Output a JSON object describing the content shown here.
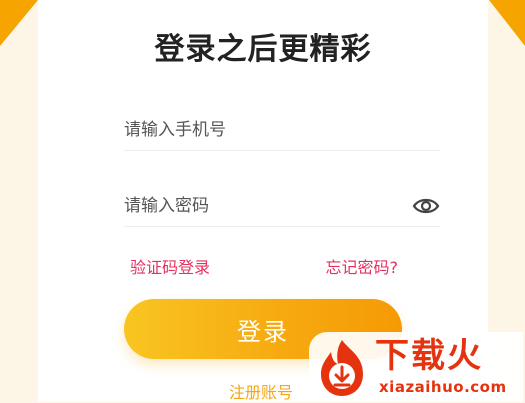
{
  "page": {
    "title": "登录之后更精彩"
  },
  "form": {
    "phone_placeholder": "请输入手机号",
    "password_placeholder": "请输入密码",
    "password_toggle_icon": "eye-icon",
    "code_login_label": "验证码登录",
    "forgot_password_label": "忘记密码?",
    "login_button_label": "登录",
    "register_label": "注册账号"
  },
  "watermark": {
    "title": "下载火",
    "url": "xiazaihuo.com",
    "logo_icon": "flame-download-icon"
  },
  "colors": {
    "accent": "#f7a80f",
    "corner": "#f6a400",
    "link": "#e5305f",
    "watermark": "#e5330f"
  }
}
